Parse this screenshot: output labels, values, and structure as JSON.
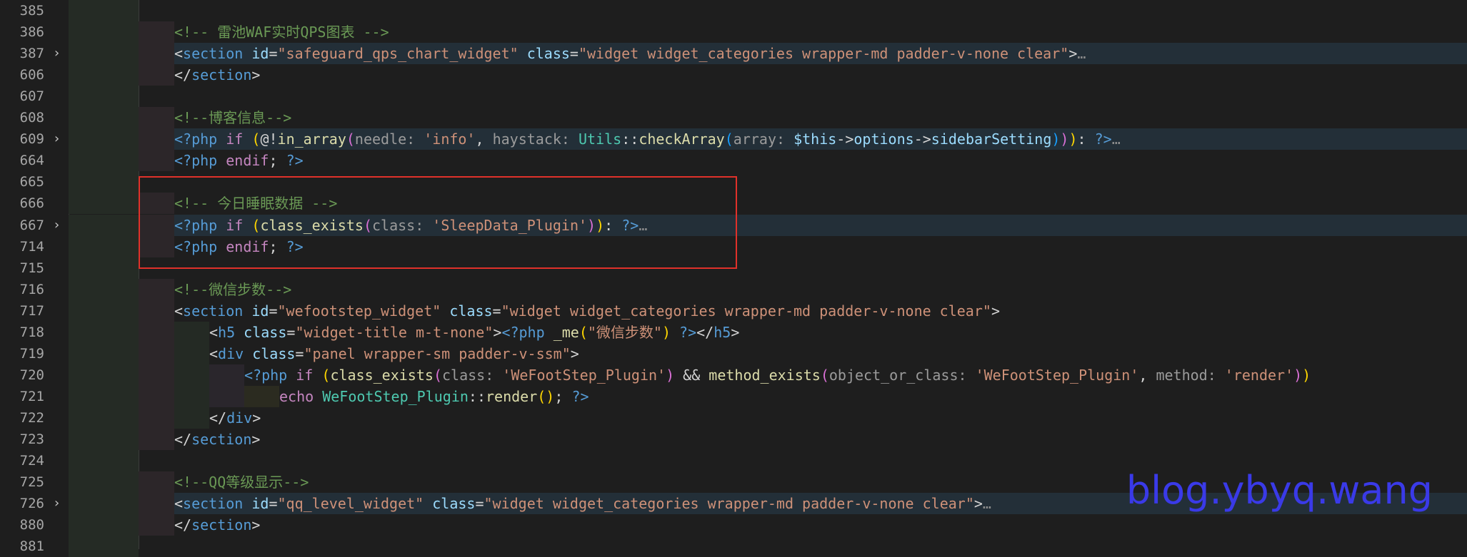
{
  "watermark": "blog.ybyq.wang",
  "lines": [
    {
      "num": "385",
      "folded": false,
      "depth": 0,
      "tokens": []
    },
    {
      "num": "386",
      "folded": false,
      "depth": 1,
      "tokens": [
        {
          "t": "<!-- 雷池WAF实时QPS图表 -->",
          "c": "com"
        }
      ]
    },
    {
      "num": "387",
      "folded": true,
      "depth": 1,
      "tokens": [
        {
          "t": "<",
          "c": "op"
        },
        {
          "t": "section",
          "c": "tag"
        },
        {
          "t": " id",
          "c": "attr"
        },
        {
          "t": "=",
          "c": "op"
        },
        {
          "t": "\"safeguard_qps_chart_widget\"",
          "c": "str"
        },
        {
          "t": " class",
          "c": "attr"
        },
        {
          "t": "=",
          "c": "op"
        },
        {
          "t": "\"widget widget_categories wrapper-md padder-v-none clear\"",
          "c": "str"
        },
        {
          "t": ">",
          "c": "op"
        },
        {
          "t": "…",
          "c": "ell"
        }
      ]
    },
    {
      "num": "606",
      "folded": false,
      "depth": 1,
      "tokens": [
        {
          "t": "</",
          "c": "op"
        },
        {
          "t": "section",
          "c": "tag"
        },
        {
          "t": ">",
          "c": "op"
        }
      ]
    },
    {
      "num": "607",
      "folded": false,
      "depth": 0,
      "tokens": []
    },
    {
      "num": "608",
      "folded": false,
      "depth": 1,
      "tokens": [
        {
          "t": "<!--博客信息-->",
          "c": "com"
        }
      ]
    },
    {
      "num": "609",
      "folded": true,
      "depth": 1,
      "tokens": [
        {
          "t": "<?php",
          "c": "php"
        },
        {
          "t": " if ",
          "c": "kw"
        },
        {
          "t": "(",
          "c": "yel"
        },
        {
          "t": "@!",
          "c": "op"
        },
        {
          "t": "in_array",
          "c": "fn"
        },
        {
          "t": "(",
          "c": "pur"
        },
        {
          "t": "needle: ",
          "c": "hint"
        },
        {
          "t": "'info'",
          "c": "str"
        },
        {
          "t": ", ",
          "c": "op"
        },
        {
          "t": "haystack: ",
          "c": "hint"
        },
        {
          "t": "Utils",
          "c": "cls"
        },
        {
          "t": "::",
          "c": "op"
        },
        {
          "t": "checkArray",
          "c": "fn"
        },
        {
          "t": "(",
          "c": "blue"
        },
        {
          "t": "array: ",
          "c": "hint"
        },
        {
          "t": "$this",
          "c": "var"
        },
        {
          "t": "->",
          "c": "op"
        },
        {
          "t": "options",
          "c": "var"
        },
        {
          "t": "->",
          "c": "op"
        },
        {
          "t": "sidebarSetting",
          "c": "var"
        },
        {
          "t": ")",
          "c": "blue"
        },
        {
          "t": ")",
          "c": "pur"
        },
        {
          "t": ")",
          "c": "yel"
        },
        {
          "t": ": ",
          "c": "op"
        },
        {
          "t": "?>",
          "c": "php"
        },
        {
          "t": "…",
          "c": "ell"
        }
      ]
    },
    {
      "num": "664",
      "folded": false,
      "depth": 1,
      "tokens": [
        {
          "t": "<?php",
          "c": "php"
        },
        {
          "t": " endif",
          "c": "kw"
        },
        {
          "t": "; ",
          "c": "op"
        },
        {
          "t": "?>",
          "c": "php"
        }
      ]
    },
    {
      "num": "665",
      "folded": false,
      "depth": 0,
      "tokens": []
    },
    {
      "num": "666",
      "folded": false,
      "depth": 1,
      "tokens": [
        {
          "t": "<!-- 今日睡眠数据 -->",
          "c": "com"
        }
      ]
    },
    {
      "num": "667",
      "folded": true,
      "depth": 1,
      "tokens": [
        {
          "t": "<?php",
          "c": "php"
        },
        {
          "t": " if ",
          "c": "kw"
        },
        {
          "t": "(",
          "c": "yel"
        },
        {
          "t": "class_exists",
          "c": "fn"
        },
        {
          "t": "(",
          "c": "pur"
        },
        {
          "t": "class: ",
          "c": "hint"
        },
        {
          "t": "'SleepData_Plugin'",
          "c": "str"
        },
        {
          "t": ")",
          "c": "pur"
        },
        {
          "t": ")",
          "c": "yel"
        },
        {
          "t": ": ",
          "c": "op"
        },
        {
          "t": "?>",
          "c": "php"
        },
        {
          "t": "…",
          "c": "ell"
        }
      ]
    },
    {
      "num": "714",
      "folded": false,
      "depth": 1,
      "tokens": [
        {
          "t": "<?php",
          "c": "php"
        },
        {
          "t": " endif",
          "c": "kw"
        },
        {
          "t": "; ",
          "c": "op"
        },
        {
          "t": "?>",
          "c": "php"
        }
      ]
    },
    {
      "num": "715",
      "folded": false,
      "depth": 0,
      "tokens": []
    },
    {
      "num": "716",
      "folded": false,
      "depth": 1,
      "tokens": [
        {
          "t": "<!--微信步数-->",
          "c": "com"
        }
      ]
    },
    {
      "num": "717",
      "folded": false,
      "depth": 1,
      "tokens": [
        {
          "t": "<",
          "c": "op"
        },
        {
          "t": "section",
          "c": "tag"
        },
        {
          "t": " id",
          "c": "attr"
        },
        {
          "t": "=",
          "c": "op"
        },
        {
          "t": "\"wefootstep_widget\"",
          "c": "str"
        },
        {
          "t": " class",
          "c": "attr"
        },
        {
          "t": "=",
          "c": "op"
        },
        {
          "t": "\"widget widget_categories wrapper-md padder-v-none clear\"",
          "c": "str"
        },
        {
          "t": ">",
          "c": "op"
        }
      ]
    },
    {
      "num": "718",
      "folded": false,
      "depth": 2,
      "tokens": [
        {
          "t": "<",
          "c": "op"
        },
        {
          "t": "h5",
          "c": "tag"
        },
        {
          "t": " class",
          "c": "attr"
        },
        {
          "t": "=",
          "c": "op"
        },
        {
          "t": "\"widget-title m-t-none\"",
          "c": "str"
        },
        {
          "t": ">",
          "c": "op"
        },
        {
          "t": "<?php",
          "c": "php"
        },
        {
          "t": " _me",
          "c": "fn"
        },
        {
          "t": "(",
          "c": "yel"
        },
        {
          "t": "\"微信步数\"",
          "c": "str"
        },
        {
          "t": ")",
          "c": "yel"
        },
        {
          "t": " ?>",
          "c": "php"
        },
        {
          "t": "</",
          "c": "op"
        },
        {
          "t": "h5",
          "c": "tag"
        },
        {
          "t": ">",
          "c": "op"
        }
      ]
    },
    {
      "num": "719",
      "folded": false,
      "depth": 2,
      "tokens": [
        {
          "t": "<",
          "c": "op"
        },
        {
          "t": "div",
          "c": "tag"
        },
        {
          "t": " class",
          "c": "attr"
        },
        {
          "t": "=",
          "c": "op"
        },
        {
          "t": "\"panel wrapper-sm padder-v-ssm\"",
          "c": "str"
        },
        {
          "t": ">",
          "c": "op"
        }
      ]
    },
    {
      "num": "720",
      "folded": false,
      "depth": 3,
      "tokens": [
        {
          "t": "<?php",
          "c": "php"
        },
        {
          "t": " if ",
          "c": "kw"
        },
        {
          "t": "(",
          "c": "yel"
        },
        {
          "t": "class_exists",
          "c": "fn"
        },
        {
          "t": "(",
          "c": "pur"
        },
        {
          "t": "class: ",
          "c": "hint"
        },
        {
          "t": "'WeFootStep_Plugin'",
          "c": "str"
        },
        {
          "t": ")",
          "c": "pur"
        },
        {
          "t": " && ",
          "c": "op"
        },
        {
          "t": "method_exists",
          "c": "fn"
        },
        {
          "t": "(",
          "c": "pur"
        },
        {
          "t": "object_or_class: ",
          "c": "hint"
        },
        {
          "t": "'WeFootStep_Plugin'",
          "c": "str"
        },
        {
          "t": ", ",
          "c": "op"
        },
        {
          "t": "method: ",
          "c": "hint"
        },
        {
          "t": "'render'",
          "c": "str"
        },
        {
          "t": ")",
          "c": "pur"
        },
        {
          "t": ")",
          "c": "yel"
        }
      ]
    },
    {
      "num": "721",
      "folded": false,
      "depth": 4,
      "tokens": [
        {
          "t": "echo ",
          "c": "kw"
        },
        {
          "t": "WeFootStep_Plugin",
          "c": "cls"
        },
        {
          "t": "::",
          "c": "op"
        },
        {
          "t": "render",
          "c": "fn"
        },
        {
          "t": "()",
          "c": "yel"
        },
        {
          "t": "; ",
          "c": "op"
        },
        {
          "t": "?>",
          "c": "php"
        }
      ]
    },
    {
      "num": "722",
      "folded": false,
      "depth": 2,
      "tokens": [
        {
          "t": "</",
          "c": "op"
        },
        {
          "t": "div",
          "c": "tag"
        },
        {
          "t": ">",
          "c": "op"
        }
      ]
    },
    {
      "num": "723",
      "folded": false,
      "depth": 1,
      "tokens": [
        {
          "t": "</",
          "c": "op"
        },
        {
          "t": "section",
          "c": "tag"
        },
        {
          "t": ">",
          "c": "op"
        }
      ]
    },
    {
      "num": "724",
      "folded": false,
      "depth": 0,
      "tokens": []
    },
    {
      "num": "725",
      "folded": false,
      "depth": 1,
      "tokens": [
        {
          "t": "<!--QQ等级显示-->",
          "c": "com"
        }
      ]
    },
    {
      "num": "726",
      "folded": true,
      "depth": 1,
      "tokens": [
        {
          "t": "<",
          "c": "op"
        },
        {
          "t": "section",
          "c": "tag"
        },
        {
          "t": " id",
          "c": "attr"
        },
        {
          "t": "=",
          "c": "op"
        },
        {
          "t": "\"qq_level_widget\"",
          "c": "str"
        },
        {
          "t": " class",
          "c": "attr"
        },
        {
          "t": "=",
          "c": "op"
        },
        {
          "t": "\"widget widget_categories wrapper-md padder-v-none clear\"",
          "c": "str"
        },
        {
          "t": ">",
          "c": "op"
        },
        {
          "t": "…",
          "c": "ell"
        }
      ]
    },
    {
      "num": "880",
      "folded": false,
      "depth": 1,
      "tokens": [
        {
          "t": "</",
          "c": "op"
        },
        {
          "t": "section",
          "c": "tag"
        },
        {
          "t": ">",
          "c": "op"
        }
      ]
    },
    {
      "num": "881",
      "folded": false,
      "depth": 0,
      "tokens": []
    }
  ]
}
